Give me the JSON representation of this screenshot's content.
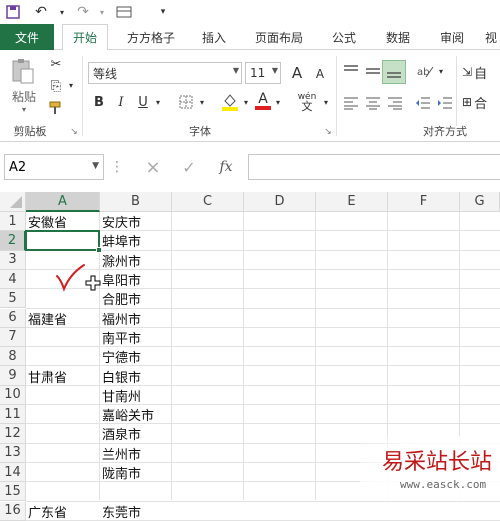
{
  "quick_access": {
    "save_icon": "save-icon",
    "undo_icon": "undo-icon",
    "redo_icon": "redo-icon"
  },
  "tabs": [
    "文件",
    "开始",
    "方方格子",
    "插入",
    "页面布局",
    "公式",
    "数据",
    "审阅",
    "视"
  ],
  "ribbon": {
    "clipboard": {
      "paste_label": "粘贴",
      "group_label": "剪贴板"
    },
    "font": {
      "font_name": "等线",
      "font_size": "11",
      "bold": "B",
      "italic": "I",
      "underline": "U",
      "group_label": "字体",
      "grow": "A",
      "shrink": "A",
      "wen": "wén",
      "wen2": "文"
    },
    "alignment": {
      "group_label": "对齐方式",
      "wrap": "自",
      "merge": "合"
    }
  },
  "formula_bar": {
    "name_box": "A2",
    "fx": "fx",
    "cancel": "×",
    "confirm": "✓",
    "formula": ""
  },
  "columns": [
    "A",
    "B",
    "C",
    "D",
    "E",
    "F",
    "G"
  ],
  "rows": [
    "1",
    "2",
    "3",
    "4",
    "5",
    "6",
    "7",
    "8",
    "9",
    "10",
    "11",
    "12",
    "13",
    "14",
    "15",
    "16"
  ],
  "cells": {
    "A1": "安徽省",
    "B1": "安庆市",
    "B2": "蚌埠市",
    "B3": "滁州市",
    "B4": "阜阳市",
    "B5": "合肥市",
    "A6": "福建省",
    "B6": "福州市",
    "B7": "南平市",
    "B8": "宁德市",
    "A9": "甘肃省",
    "B9": "白银市",
    "B10": "甘南州",
    "B11": "嘉峪关市",
    "B12": "酒泉市",
    "B13": "兰州市",
    "B14": "陇南市",
    "A16": "广东省",
    "B16": "东莞市"
  },
  "watermark": {
    "title": "易采站长站",
    "url": "www.easck.com"
  },
  "colors": {
    "accent": "#217346",
    "checkmark": "#d02020"
  }
}
